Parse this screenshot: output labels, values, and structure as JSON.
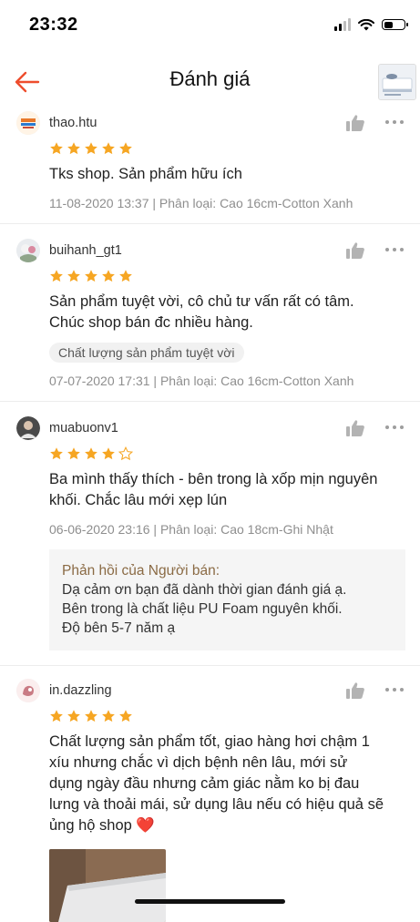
{
  "status": {
    "time": "23:32",
    "battery_level": 0.45
  },
  "header": {
    "title": "Đánh giá",
    "back_icon": "arrow-left-icon",
    "accent": "#ee4d2d"
  },
  "colors": {
    "star": "#f6a623",
    "reply_title": "#8a6a44"
  },
  "reviews": [
    {
      "user": "thao.htu",
      "rating": 5,
      "comment": [
        "Tks shop. Sản phẩm hữu ích"
      ],
      "meta": "11-08-2020 13:37 | Phân loại: Cao 16cm-Cotton Xanh"
    },
    {
      "user": "buihanh_gt1",
      "rating": 5,
      "comment": [
        "Sản phẩm tuyệt vời, cô chủ tư vấn rất có tâm.",
        "Chúc shop bán đc nhiều hàng."
      ],
      "tag": "Chất lượng sản phẩm tuyệt vời",
      "meta": "07-07-2020 17:31 | Phân loại: Cao 16cm-Cotton Xanh"
    },
    {
      "user": "muabuonv1",
      "rating": 4,
      "comment": [
        "Ba mình thấy thích - bên trong là xốp mịn nguyên",
        "khối. Chắc lâu mới xẹp lún"
      ],
      "meta": "06-06-2020 23:16 | Phân loại: Cao 18cm-Ghi Nhật",
      "seller_reply": {
        "title": "Phản hồi của Người bán:",
        "lines": [
          "Dạ cảm ơn bạn đã dành thời gian đánh giá ạ.",
          "Bên trong là chất liệu PU Foam nguyên khối.",
          "Độ bên 5-7 năm ạ"
        ]
      }
    },
    {
      "user": "in.dazzling",
      "rating": 5,
      "comment": [
        "Chất lượng sản phẩm tốt, giao hàng hơi chậm 1",
        "xíu nhưng chắc vì dịch bệnh nên lâu, mới sử",
        "dụng ngày đầu nhưng cảm giác nằm ko bị đau",
        "lưng và thoải mái, sử dụng lâu nếu có hiệu quả sẽ",
        "ủng hộ shop ❤️"
      ]
    }
  ]
}
